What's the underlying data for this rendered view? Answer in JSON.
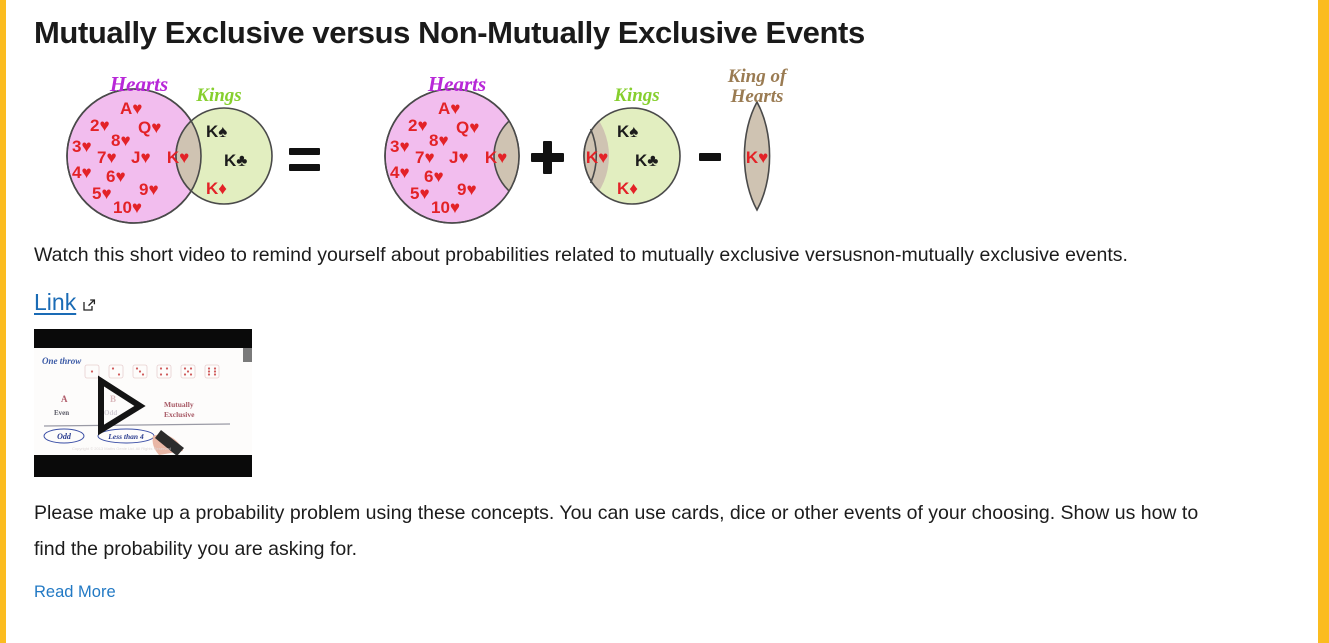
{
  "theme": {
    "accent_bar_color": "#fbbc1f",
    "link_color": "#1a6bb5",
    "read_more_color": "#2279c4",
    "hearts_fill": "#f2bdee",
    "kings_fill": "#e2eec0",
    "overlap_fill": "#cfc3b2",
    "hearts_label_color": "#b828d8",
    "kings_label_color": "#86cf2e",
    "king_of_hearts_label_color": "#9a7b52",
    "card_red": "#e32227",
    "card_black": "#1c1c1c"
  },
  "header": {
    "title": "Mutually Exclusive versus Non-Mutually Exclusive Events"
  },
  "venn": {
    "operators": {
      "equals": "=",
      "plus": "+",
      "minus": "-"
    },
    "group1": {
      "left_label": "Hearts",
      "right_label": "Kings",
      "hearts_only": [
        "A♥",
        "2♥",
        "Q♥",
        "8♥",
        "3♥",
        "7♥",
        "J♥",
        "4♥",
        "6♥",
        "5♥",
        "9♥",
        "10♥"
      ],
      "overlap": [
        "K♥"
      ],
      "kings_only": [
        "K♠",
        "K♣",
        "K♦"
      ]
    },
    "group2": {
      "label": "Hearts",
      "hearts_only": [
        "A♥",
        "2♥",
        "Q♥",
        "8♥",
        "3♥",
        "7♥",
        "J♥",
        "4♥",
        "6♥",
        "5♥",
        "9♥",
        "10♥"
      ],
      "overlap": [
        "K♥"
      ]
    },
    "group3": {
      "label": "Kings",
      "overlap": [
        "K♥"
      ],
      "kings_only": [
        "K♠",
        "K♣",
        "K♦"
      ]
    },
    "group4": {
      "label_line1": "King of",
      "label_line2": "Hearts",
      "lens": [
        "K♥"
      ]
    }
  },
  "body": {
    "paragraph_watch": "Watch this short video to remind yourself about probabilities related to mutually exclusive versusnon-mutually exclusive events.",
    "paragraph_please": "Please make up a probability problem using these concepts.  You can use cards, dice or other events of your choosing.   Show us how to find the probability you are asking for."
  },
  "link": {
    "label": "Link",
    "external_icon": "external-link-icon"
  },
  "video": {
    "alt": "whiteboard animation thumbnail",
    "handwritten": {
      "heading": "One throw",
      "label_a": "A",
      "label_a_sub": "Even",
      "label_b": "B",
      "label_b_sub": "Odd",
      "result": "Mutually Exclusive",
      "bubble_left": "Odd",
      "bubble_right": "Less than 4"
    },
    "play_icon": "play-triangle-icon"
  },
  "footer": {
    "read_more": "Read More"
  }
}
